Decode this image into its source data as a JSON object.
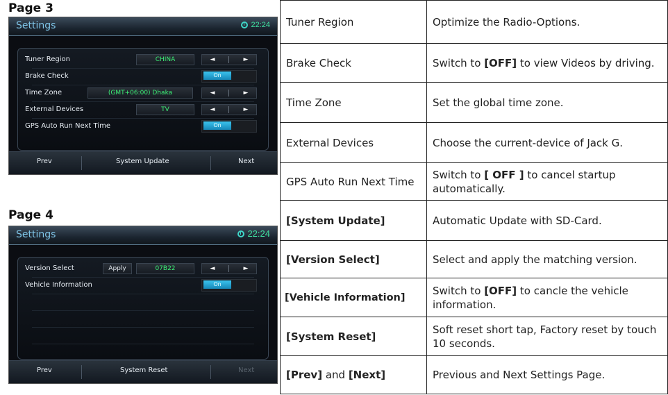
{
  "page3": {
    "label": "Page 3",
    "title": "Settings",
    "time": "22:24",
    "rows": [
      {
        "label": "Tuner Region",
        "value": "CHINA"
      },
      {
        "label": "Brake Check",
        "toggle": "On"
      },
      {
        "label": "Time Zone",
        "value": "(GMT+06:00) Dhaka"
      },
      {
        "label": "External Devices",
        "value": "TV"
      },
      {
        "label": "GPS Auto Run Next Time",
        "toggle": "On"
      }
    ],
    "arrow_left": "◄",
    "arrow_right": "►",
    "footer": {
      "prev": "Prev",
      "center": "System Update",
      "next": "Next"
    }
  },
  "page4": {
    "label": "Page 4",
    "title": "Settings",
    "time": "22:24",
    "rows": [
      {
        "label": "Version Select",
        "apply": "Apply",
        "value": "07B22"
      },
      {
        "label": "Vehicle Information",
        "toggle": "On"
      }
    ],
    "arrow_left": "◄",
    "arrow_right": "►",
    "footer": {
      "prev": "Prev",
      "center": "System Reset",
      "next": "Next"
    }
  },
  "table": [
    {
      "name": "Tuner Region",
      "name_bold": false,
      "desc": "Optimize the Radio-Options."
    },
    {
      "name": "Brake Check",
      "name_bold": false,
      "desc_pre": "Switch to ",
      "desc_bold": "[OFF]",
      "desc_post": " to view Videos by driving."
    },
    {
      "name": "Time Zone",
      "name_bold": false,
      "desc": "Set the global time zone."
    },
    {
      "name": "External Devices",
      "name_bold": false,
      "desc": "Choose the current-device  of Jack G."
    },
    {
      "name": "GPS Auto Run Next Time",
      "name_bold": false,
      "desc_pre": "Switch  to ",
      "desc_bold": "[ OFF ]",
      "desc_post": " to cancel startup automatically."
    },
    {
      "name": "[System Update]",
      "name_bold": true,
      "desc": "Automatic Update with SD-Card."
    },
    {
      "name": "[Version Select]",
      "name_bold": true,
      "desc": "Select and apply the matching version."
    },
    {
      "name": "[Vehicle Information]",
      "name_bold": true,
      "desc_pre": "Switch to ",
      "desc_bold": "[OFF]",
      "desc_post": " to cancle the vehicle information."
    },
    {
      "name": "[System Reset]",
      "name_bold": true,
      "desc": "Soft reset short tap, Factory reset by touch 10 seconds."
    },
    {
      "name_b1": "[Prev]",
      "name_mid": " and ",
      "name_b2": "[Next]",
      "desc": "Previous and Next Settings Page."
    }
  ]
}
